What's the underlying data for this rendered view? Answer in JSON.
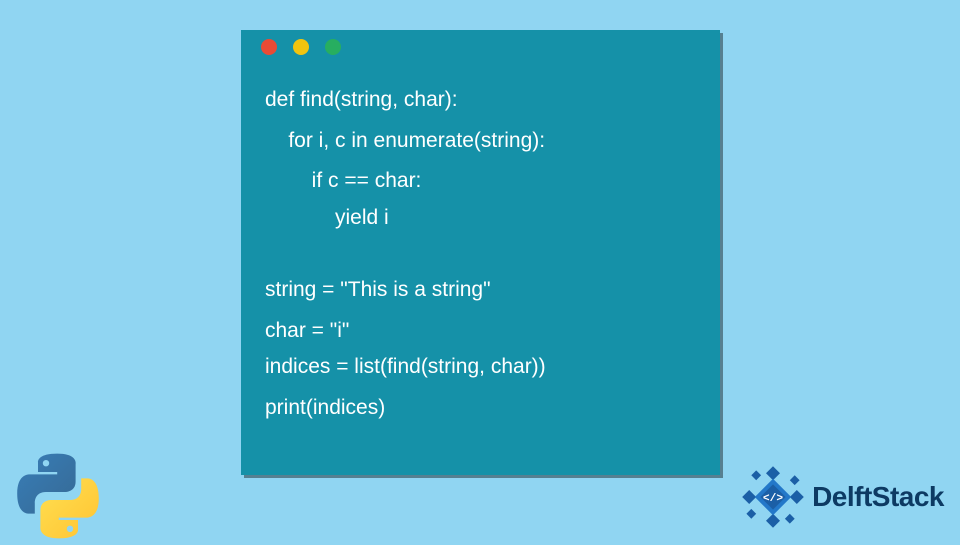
{
  "code": {
    "line1": "def find(string, char):",
    "line2": "    for i, c in enumerate(string):",
    "line3": "        if c == char:",
    "line4": "            yield i",
    "line5": "string = \"This is a string\"",
    "line6": "char = \"i\"",
    "line7": "indices = list(find(string, char))",
    "line8": "print(indices)"
  },
  "brand": {
    "name": "DelftStack"
  }
}
